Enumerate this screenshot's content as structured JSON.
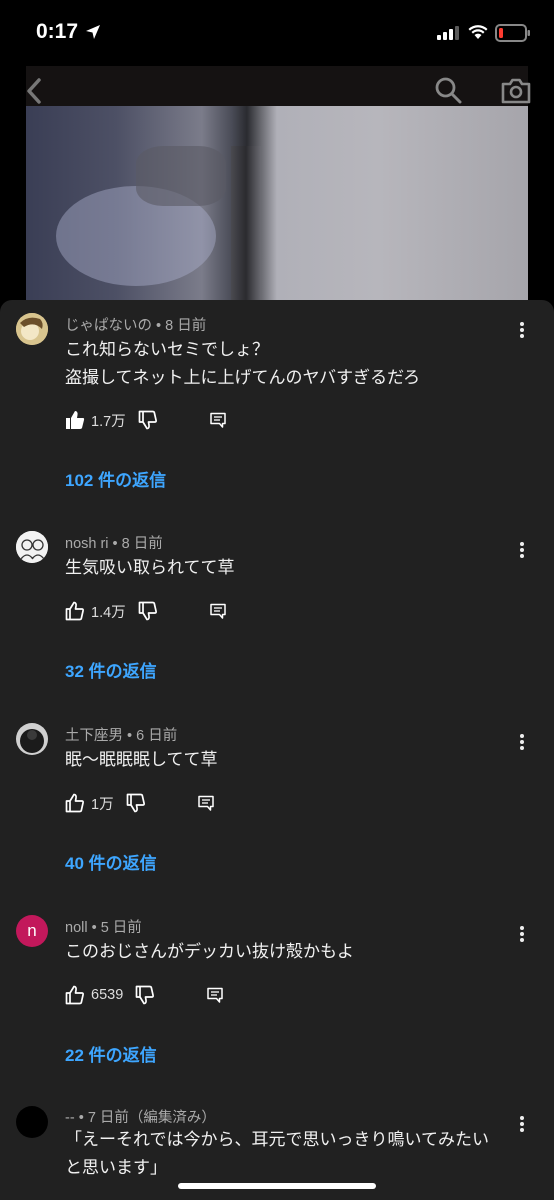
{
  "status_bar": {
    "time": "0:17"
  },
  "comments": [
    {
      "author": "じゃぱないの",
      "age": "8 日前",
      "lines": [
        "これ知らないセミでしょ？",
        "盗撮してネット上に上げてんのヤバすぎるだろ"
      ],
      "likes": "1.7万",
      "replies": "102 件の返信",
      "avatar_color": "#c9b37a",
      "avatar_letter": ""
    },
    {
      "author": "nosh ri",
      "age": "8 日前",
      "lines": [
        "生気吸い取られてて草"
      ],
      "likes": "1.4万",
      "replies": "32 件の返信",
      "avatar_color": "#e8e8e8",
      "avatar_letter": ""
    },
    {
      "author": "土下座男",
      "age": "6 日前",
      "lines": [
        "眠〜眠眠眠してて草"
      ],
      "likes": "1万",
      "replies": "40 件の返信",
      "avatar_color": "#2a2a2a",
      "avatar_letter": ""
    },
    {
      "author": "noll",
      "age": "5 日前",
      "lines": [
        "このおじさんがデッカい抜け殻かもよ"
      ],
      "likes": "6539",
      "replies": "22 件の返信",
      "avatar_color": "#c2185b",
      "avatar_letter": "n"
    },
    {
      "author": "--",
      "age": "7 日前（編集済み）",
      "lines": [
        "「えーそれでは今から、耳元で思いっきり鳴いてみたい",
        "と思います」"
      ],
      "likes": "",
      "replies": "",
      "avatar_color": "#000000",
      "avatar_letter": ""
    }
  ]
}
